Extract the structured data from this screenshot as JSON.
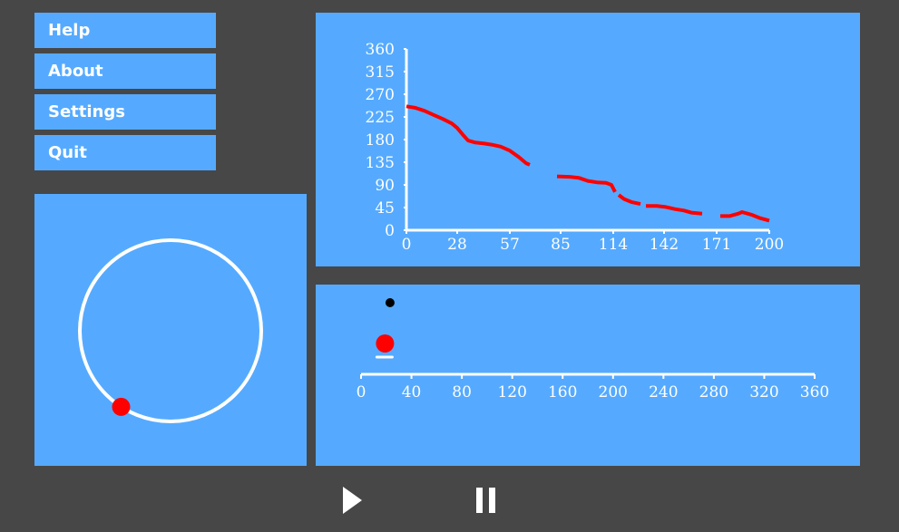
{
  "menu": {
    "items": [
      {
        "label": "Help"
      },
      {
        "label": "About"
      },
      {
        "label": "Settings"
      },
      {
        "label": "Quit"
      }
    ]
  },
  "colors": {
    "background": "#474747",
    "panel": "#55aaff",
    "axis": "#ffffff",
    "series": "#ff0000",
    "marker": "#000000"
  },
  "circle_widget": {
    "angle_deg": 237
  },
  "slider": {
    "ticks": [
      "0",
      "40",
      "80",
      "120",
      "160",
      "200",
      "240",
      "280",
      "320",
      "360"
    ],
    "min": 0,
    "max": 360,
    "value": 19,
    "marker_value": 23
  },
  "controls": {
    "play_icon": "play-icon",
    "pause_icon": "pause-icon"
  },
  "chart_data": {
    "type": "line",
    "x_ticks": [
      "0",
      "28",
      "57",
      "85",
      "114",
      "142",
      "171",
      "200"
    ],
    "y_ticks": [
      "0",
      "45",
      "90",
      "135",
      "180",
      "225",
      "270",
      "315",
      "360"
    ],
    "xlim": [
      0,
      200
    ],
    "ylim": [
      0,
      360
    ],
    "series": [
      {
        "segments": [
          [
            [
              0,
              246
            ],
            [
              5,
              243
            ],
            [
              10,
              237
            ],
            [
              15,
              229
            ],
            [
              20,
              221
            ],
            [
              25,
              212
            ],
            [
              28,
              203
            ],
            [
              31,
              190
            ],
            [
              34,
              178
            ],
            [
              38,
              174
            ],
            [
              43,
              172
            ],
            [
              47,
              170
            ],
            [
              52,
              166
            ],
            [
              57,
              158
            ],
            [
              62,
              145
            ],
            [
              66,
              133
            ],
            [
              68,
              130
            ]
          ],
          [
            [
              83,
              107
            ],
            [
              90,
              106
            ],
            [
              95,
              104
            ],
            [
              100,
              98
            ],
            [
              105,
              95
            ],
            [
              110,
              94
            ],
            [
              113,
              90
            ],
            [
              115,
              76
            ]
          ],
          [
            [
              117,
              70
            ],
            [
              120,
              62
            ],
            [
              124,
              56
            ],
            [
              129,
              52
            ]
          ],
          [
            [
              132,
              48
            ],
            [
              138,
              48
            ],
            [
              143,
              46
            ],
            [
              148,
              42
            ],
            [
              153,
              39
            ],
            [
              157,
              35
            ],
            [
              163,
              33
            ]
          ],
          [
            [
              173,
              28
            ],
            [
              178,
              28
            ],
            [
              183,
              33
            ],
            [
              185,
              36
            ],
            [
              190,
              31
            ],
            [
              195,
              24
            ],
            [
              200,
              19
            ]
          ]
        ]
      }
    ]
  }
}
